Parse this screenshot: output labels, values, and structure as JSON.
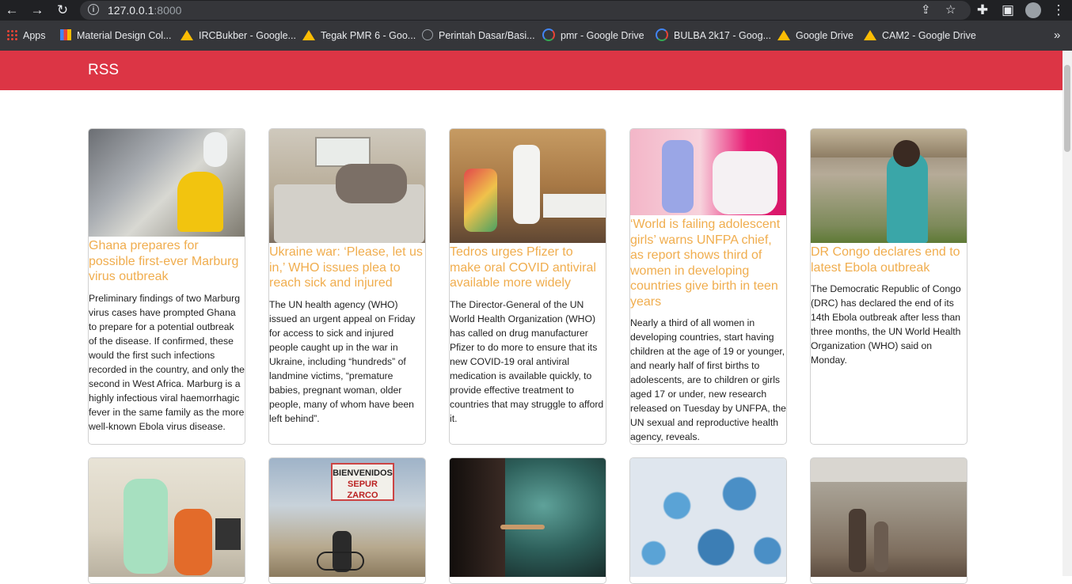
{
  "browser": {
    "url_host": "127.0.0.1",
    "url_port": ":8000",
    "bookmarks": [
      {
        "label": "Apps",
        "icon": "apps-grid-icon"
      },
      {
        "label": "Material Design Col...",
        "icon": "material-design-icon"
      },
      {
        "label": "IRCBukber - Google...",
        "icon": "google-drive-icon"
      },
      {
        "label": "Tegak PMR 6 - Goo...",
        "icon": "google-drive-icon"
      },
      {
        "label": "Perintah Dasar/Basi...",
        "icon": "globe-icon"
      },
      {
        "label": "pmr - Google Drive",
        "icon": "google-icon"
      },
      {
        "label": "BULBA 2k17 - Goog...",
        "icon": "google-icon"
      },
      {
        "label": "Google Drive",
        "icon": "google-drive-icon"
      },
      {
        "label": "CAM2 - Google Drive",
        "icon": "google-drive-icon"
      }
    ],
    "more_bookmarks": "»"
  },
  "header": {
    "brand": "RSS",
    "color": "#dc3545"
  },
  "cards": [
    {
      "title": "Ghana prepares for possible first-ever Marburg virus outbreak",
      "summary": "Preliminary findings of two Marburg virus cases have prompted Ghana to prepare for a potential outbreak of the disease. If confirmed, these would the first such infections recorded in the country, and only the second in West Africa. Marburg is a highly infectious viral haemorrhagic fever in the same family as the more well-known Ebola virus disease."
    },
    {
      "title": "Ukraine war: ‘Please, let us in,’ WHO issues plea to reach sick and injured",
      "summary": "The UN health agency (WHO) issued an urgent appeal on Friday for access to sick and injured people caught up in the war in Ukraine, including “hundreds” of landmine victims, “premature babies, pregnant woman, older people, many of whom have been left behind”."
    },
    {
      "title": "Tedros urges Pfizer to make oral COVID antiviral available more widely",
      "summary": "The Director-General of the UN World Health Organization (WHO) has called on drug manufacturer Pfizer to do more to ensure that its new COVID-19 oral antiviral medication is available quickly, to provide effective treatment to countries that may struggle to afford it."
    },
    {
      "title": "‘World is failing adolescent girls’ warns UNFPA chief, as report shows third of women in developing countries give birth in teen years",
      "summary": "Nearly a third of all women in developing countries, start having children at the age of 19 or younger, and nearly half of first births to adolescents, are to children or girls aged 17 or under, new research released on Tuesday by UNFPA, the UN sexual and reproductive health agency, reveals."
    },
    {
      "title": "DR Congo declares end to latest Ebola outbreak",
      "summary": "The Democratic Republic of Congo (DRC) has declared the end of its 14th Ebola outbreak after less than three months, the UN World Health Organization (WHO) said on Monday."
    }
  ],
  "second_row": [
    {
      "sign_text": "BIENVENIDOS"
    },
    {
      "sign_text": "SEPUR ZARCO"
    }
  ]
}
